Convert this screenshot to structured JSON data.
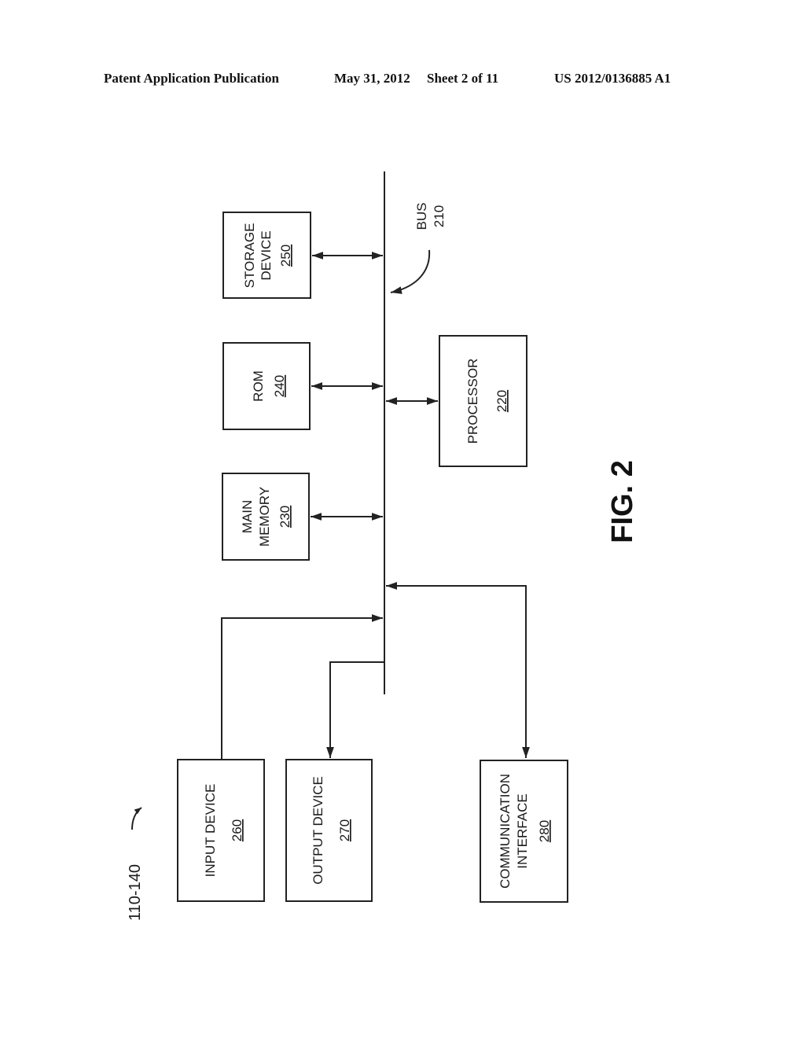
{
  "header": {
    "publication": "Patent Application Publication",
    "date": "May 31, 2012",
    "sheet": "Sheet 2 of 11",
    "number": "US 2012/0136885 A1"
  },
  "figure": {
    "label": "FIG. 2",
    "device_ref": "110-140",
    "bus": {
      "label": "BUS",
      "ref": "210"
    },
    "components": {
      "storage": {
        "lines": [
          "STORAGE",
          "DEVICE"
        ],
        "ref": "250"
      },
      "rom": {
        "lines": [
          "ROM"
        ],
        "ref": "240"
      },
      "main_memory": {
        "lines": [
          "MAIN",
          "MEMORY"
        ],
        "ref": "230"
      },
      "processor": {
        "lines": [
          "PROCESSOR"
        ],
        "ref": "220"
      },
      "input": {
        "lines": [
          "INPUT DEVICE"
        ],
        "ref": "260"
      },
      "output": {
        "lines": [
          "OUTPUT DEVICE"
        ],
        "ref": "270"
      },
      "comm": {
        "lines": [
          "COMMUNICATION",
          "INTERFACE"
        ],
        "ref": "280"
      }
    }
  }
}
